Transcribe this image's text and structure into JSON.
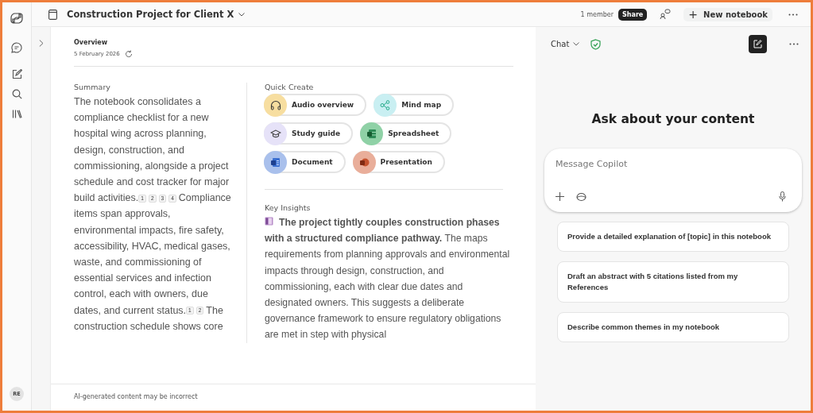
{
  "topbar": {
    "title": "Construction Project for Client X",
    "members": "1 member",
    "share": "Share",
    "new_notebook": "New notebook",
    "new_notebook_icon": "+"
  },
  "rail": {
    "avatar": "RE"
  },
  "overview": {
    "title": "Overview",
    "date": "5 February 2026"
  },
  "summary": {
    "label": "Summary",
    "parts": [
      {
        "kind": "text",
        "text": "The notebook consolidates a compliance checklist for a new hospital wing across planning, design, construction, and commissioning, alongside a project schedule and cost tracker for major build activities."
      },
      {
        "kind": "cite",
        "text": "1"
      },
      {
        "kind": "cite",
        "text": "2"
      },
      {
        "kind": "cite",
        "text": "3"
      },
      {
        "kind": "cite",
        "text": "4"
      },
      {
        "kind": "text",
        "text": "Compliance items span approvals, environmental impacts, fire safety, accessibility, HVAC, medical gases, waste, and commissioning of essential services and infection control, each with owners, due dates, and current status."
      },
      {
        "kind": "cite",
        "text": "1"
      },
      {
        "kind": "cite",
        "text": "2"
      },
      {
        "kind": "text",
        "text": "The construction schedule shows core"
      }
    ]
  },
  "quick_create": {
    "label": "Quick Create",
    "items": [
      {
        "label": "Audio overview",
        "kind": "audio",
        "color": "#f7dea0"
      },
      {
        "label": "Mind map",
        "kind": "mindmap",
        "color": "#c9eff2"
      },
      {
        "label": "Study guide",
        "kind": "study",
        "color": "#e6e2f8"
      },
      {
        "label": "Spreadsheet",
        "kind": "sheet",
        "color": "#8fd1a6"
      },
      {
        "label": "Document",
        "kind": "doc",
        "color": "#a9c0ec"
      },
      {
        "label": "Presentation",
        "kind": "slides",
        "color": "#e9ae9a"
      }
    ]
  },
  "insights": {
    "label": "Key Insights",
    "text": "**The project tightly couples construction phases with a structured compliance pathway.** The maps requirements from planning approvals and environmental impacts through design, construction, and commissioning, each with clear due dates and designated owners. This suggests a deliberate governance framework to ensure regulatory obligations are met in step with physical"
  },
  "footer": "AI-generated content may be incorrect",
  "chat": {
    "mode": "Chat",
    "heading": "Ask about your content",
    "placeholder": "Message Copilot",
    "suggestions": [
      "Provide a detailed explanation of [topic] in this notebook",
      "Draft an abstract with 5 citations listed from my References",
      "Describe common themes in my notebook"
    ]
  }
}
